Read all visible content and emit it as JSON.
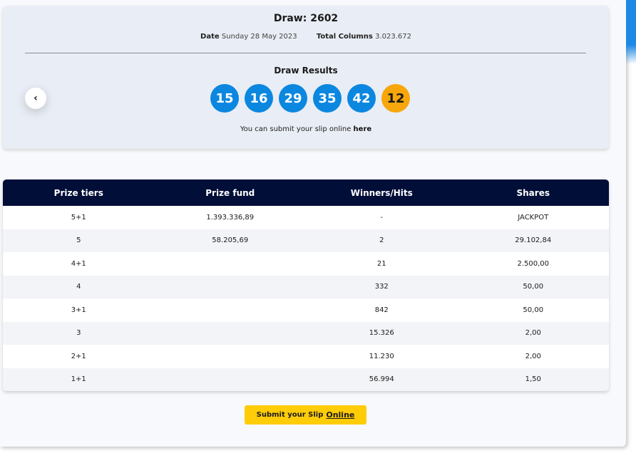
{
  "draw": {
    "title": "Draw: 2602",
    "date_label": "Date",
    "date_value": "Sunday 28 May 2023",
    "columns_label": "Total Columns",
    "columns_value": "3.023.672"
  },
  "results": {
    "title": "Draw Results",
    "numbers": [
      "15",
      "16",
      "29",
      "35",
      "42"
    ],
    "bonus": "12",
    "back_icon": "chevron-left-icon",
    "note_text": "You can submit your slip online ",
    "note_link": "here"
  },
  "colors": {
    "ball": "#0b87e0",
    "bonus_ball": "#f7a70c",
    "table_header": "#000e38",
    "submit_button": "#ffcc08"
  },
  "prize_table": {
    "headers": [
      "Prize tiers",
      "Prize fund",
      "Winners/Hits",
      "Shares"
    ],
    "rows": [
      [
        "5+1",
        "1.393.336,89",
        "-",
        "JACKPOT"
      ],
      [
        "5",
        "58.205,69",
        "2",
        "29.102,84"
      ],
      [
        "4+1",
        "",
        "21",
        "2.500,00"
      ],
      [
        "4",
        "",
        "332",
        "50,00"
      ],
      [
        "3+1",
        "",
        "842",
        "50,00"
      ],
      [
        "3",
        "",
        "15.326",
        "2,00"
      ],
      [
        "2+1",
        "",
        "11.230",
        "2,00"
      ],
      [
        "1+1",
        "",
        "56.994",
        "1,50"
      ]
    ]
  },
  "submit": {
    "label": "Submit your Slip",
    "link": "Online"
  }
}
